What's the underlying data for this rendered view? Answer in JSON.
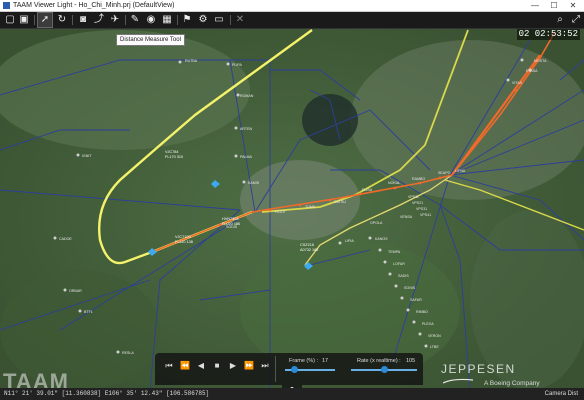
{
  "window": {
    "title": "TAAM Viewer Light - Ho_Chi_Minh.prj (DefaultView)",
    "minimize": "—",
    "maximize": "☐",
    "close": "✕"
  },
  "toolbar": {
    "tooltip": "Distance Measure Tool",
    "icons": [
      "view-menu-icon",
      "layers-icon",
      "pointer-icon",
      "rotate-icon",
      "camera-icon",
      "route-icon",
      "flight-icon",
      "note-icon",
      "target-icon",
      "chart-icon",
      "flag-icon",
      "gear-icon",
      "screen-icon",
      "close-icon",
      "search-icon",
      "expand-icon"
    ]
  },
  "clock": "02 02:53:52",
  "map": {
    "waypoints": [
      "RUTBA",
      "PLIPA",
      "ROMAN",
      "ARTEN",
      "PALMA",
      "KAMIS",
      "IGNIT",
      "CADOE",
      "ORBAR",
      "BTF1",
      "RESLA",
      "TAMUB",
      "SODIS",
      "PIDOT",
      "TOMIL",
      "DATSU",
      "ELISA",
      "NOKAL",
      "RAMBO",
      "SEAPO",
      "LIFNA",
      "VITAS",
      "MOSTA",
      "ETASA",
      "VENSA",
      "OPOLA",
      "LIPIA",
      "KANOS",
      "TEMPA",
      "LOFAR",
      "SADIS",
      "SONIS",
      "SAFAR",
      "RIMBO",
      "PLEXA",
      "VERON",
      "VPS11",
      "VPS21",
      "VPS31",
      "VPS41",
      "LTBE"
    ],
    "flight_labels": [
      {
        "callsign": "VJC784",
        "info": "FL170 310"
      },
      {
        "callsign": "HVN7303",
        "info": "FL020 186"
      },
      {
        "callsign": "VJC7109",
        "info": "FL110 138"
      },
      {
        "callsign": "CSZ216",
        "info": "A0732 182"
      }
    ]
  },
  "playback": {
    "frame_label": "Frame (%) :",
    "frame_value": "17",
    "rate_label": "Rate (x realtime) :",
    "rate_value": "105",
    "frame_fraction": 0.17,
    "rate_fraction": 0.5
  },
  "branding": {
    "app": "TAAM",
    "vendor": "JEPPESEN",
    "parent": "A Boeing Company"
  },
  "status": {
    "coordinates": "N11° 21' 39.01\" [11.360838]   E106° 35' 12.43\" [106.586785]",
    "camera": "Camera Dist"
  },
  "colors": {
    "route_yellow": "#f4f26a",
    "route_orange": "#f06a2a",
    "airspace_blue": "#2c3f9a",
    "slider_blue": "#2b8ad8",
    "play_green": "#35d050"
  }
}
